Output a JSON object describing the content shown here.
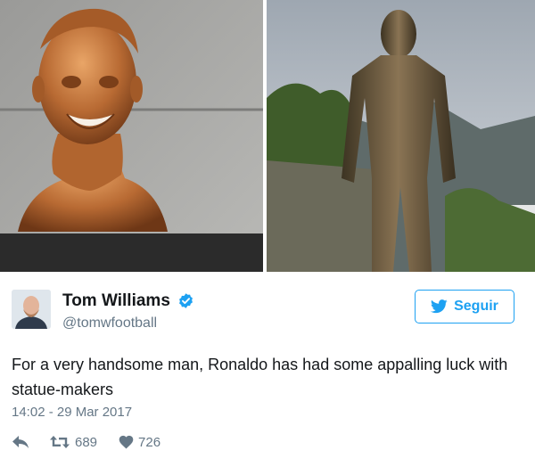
{
  "media": {
    "left_photo": "bronze bust photo",
    "right_photo": "bronze statue photo"
  },
  "tweet": {
    "author_name": "Tom Williams",
    "author_handle": "@tomwfootball",
    "follow_label": "Seguir",
    "text": "For a very handsome man, Ronaldo has had some appalling luck with statue-makers",
    "timestamp": "14:02 - 29 Mar 2017",
    "retweet_count": "689",
    "like_count": "726"
  },
  "colors": {
    "accent": "#1da1f2",
    "text": "#14171a",
    "muted": "#657786"
  },
  "icons": [
    "verified-badge-icon",
    "twitter-bird-icon",
    "reply-icon",
    "retweet-icon",
    "heart-icon"
  ]
}
